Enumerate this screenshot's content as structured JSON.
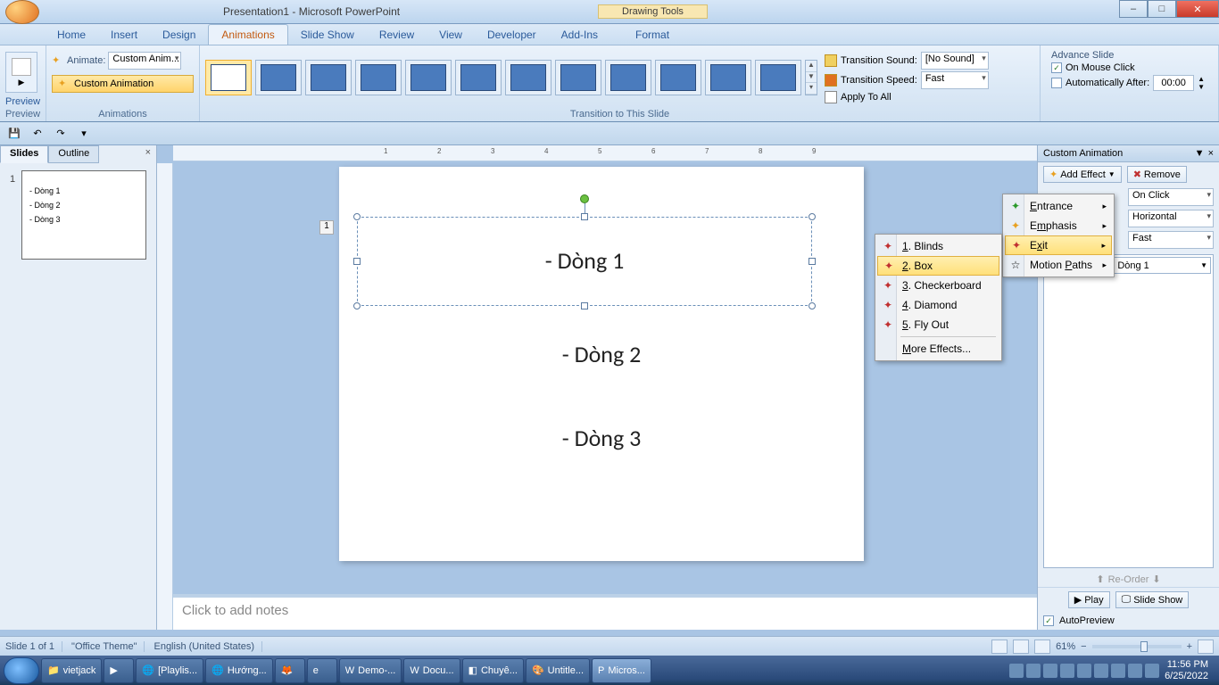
{
  "title": "Presentation1 - Microsoft PowerPoint",
  "contextual_tab_group": "Drawing Tools",
  "ribbon_tabs": [
    "Home",
    "Insert",
    "Design",
    "Animations",
    "Slide Show",
    "Review",
    "View",
    "Developer",
    "Add-Ins",
    "Format"
  ],
  "active_tab": "Animations",
  "preview": {
    "label": "Preview",
    "group": "Preview"
  },
  "animations_group": {
    "label": "Animations",
    "animate_label": "Animate:",
    "animate_value": "Custom Anim...",
    "custom_btn": "Custom Animation"
  },
  "transition_group": {
    "label": "Transition to This Slide",
    "sound_label": "Transition Sound:",
    "sound_value": "[No Sound]",
    "speed_label": "Transition Speed:",
    "speed_value": "Fast",
    "apply_all": "Apply To All"
  },
  "advance_group": {
    "label": "Advance Slide",
    "on_click": "On Mouse Click",
    "auto_after": "Automatically After:",
    "auto_value": "00:00"
  },
  "side_tabs": {
    "slides": "Slides",
    "outline": "Outline"
  },
  "thumb_lines": [
    "- Dòng 1",
    "- Dòng 2",
    "- Dòng 3"
  ],
  "slide": {
    "line1": "- Dòng 1",
    "line2": "- Dòng 2",
    "line3": "- Dòng 3",
    "tag": "1"
  },
  "notes_placeholder": "Click to add notes",
  "taskpane": {
    "title": "Custom Animation",
    "add_effect": "Add Effect",
    "remove": "Remove",
    "start_value": "On Click",
    "property_value": "Horizontal",
    "speed_value": "Fast",
    "item": "Title 1: - Dòng 1",
    "reorder": "Re-Order",
    "play": "Play",
    "slideshow": "Slide Show",
    "autopreview": "AutoPreview"
  },
  "add_effect_menu": {
    "entrance": "Entrance",
    "emphasis": "Emphasis",
    "exit": "Exit",
    "motion": "Motion Paths"
  },
  "exit_menu": {
    "i1": "1. Blinds",
    "i2": "2. Box",
    "i3": "3. Checkerboard",
    "i4": "4. Diamond",
    "i5": "5. Fly Out",
    "more": "More Effects..."
  },
  "statusbar": {
    "slide": "Slide 1 of 1",
    "theme": "\"Office Theme\"",
    "lang": "English (United States)",
    "zoom": "61%"
  },
  "taskbar": {
    "items": [
      "vietjack",
      "",
      "[Playlis...",
      "Hướng...",
      "",
      "",
      "Demo-...",
      "Docu...",
      "Chuyê...",
      "Untitle...",
      "Micros..."
    ],
    "time": "11:56 PM",
    "date": "6/25/2022"
  }
}
